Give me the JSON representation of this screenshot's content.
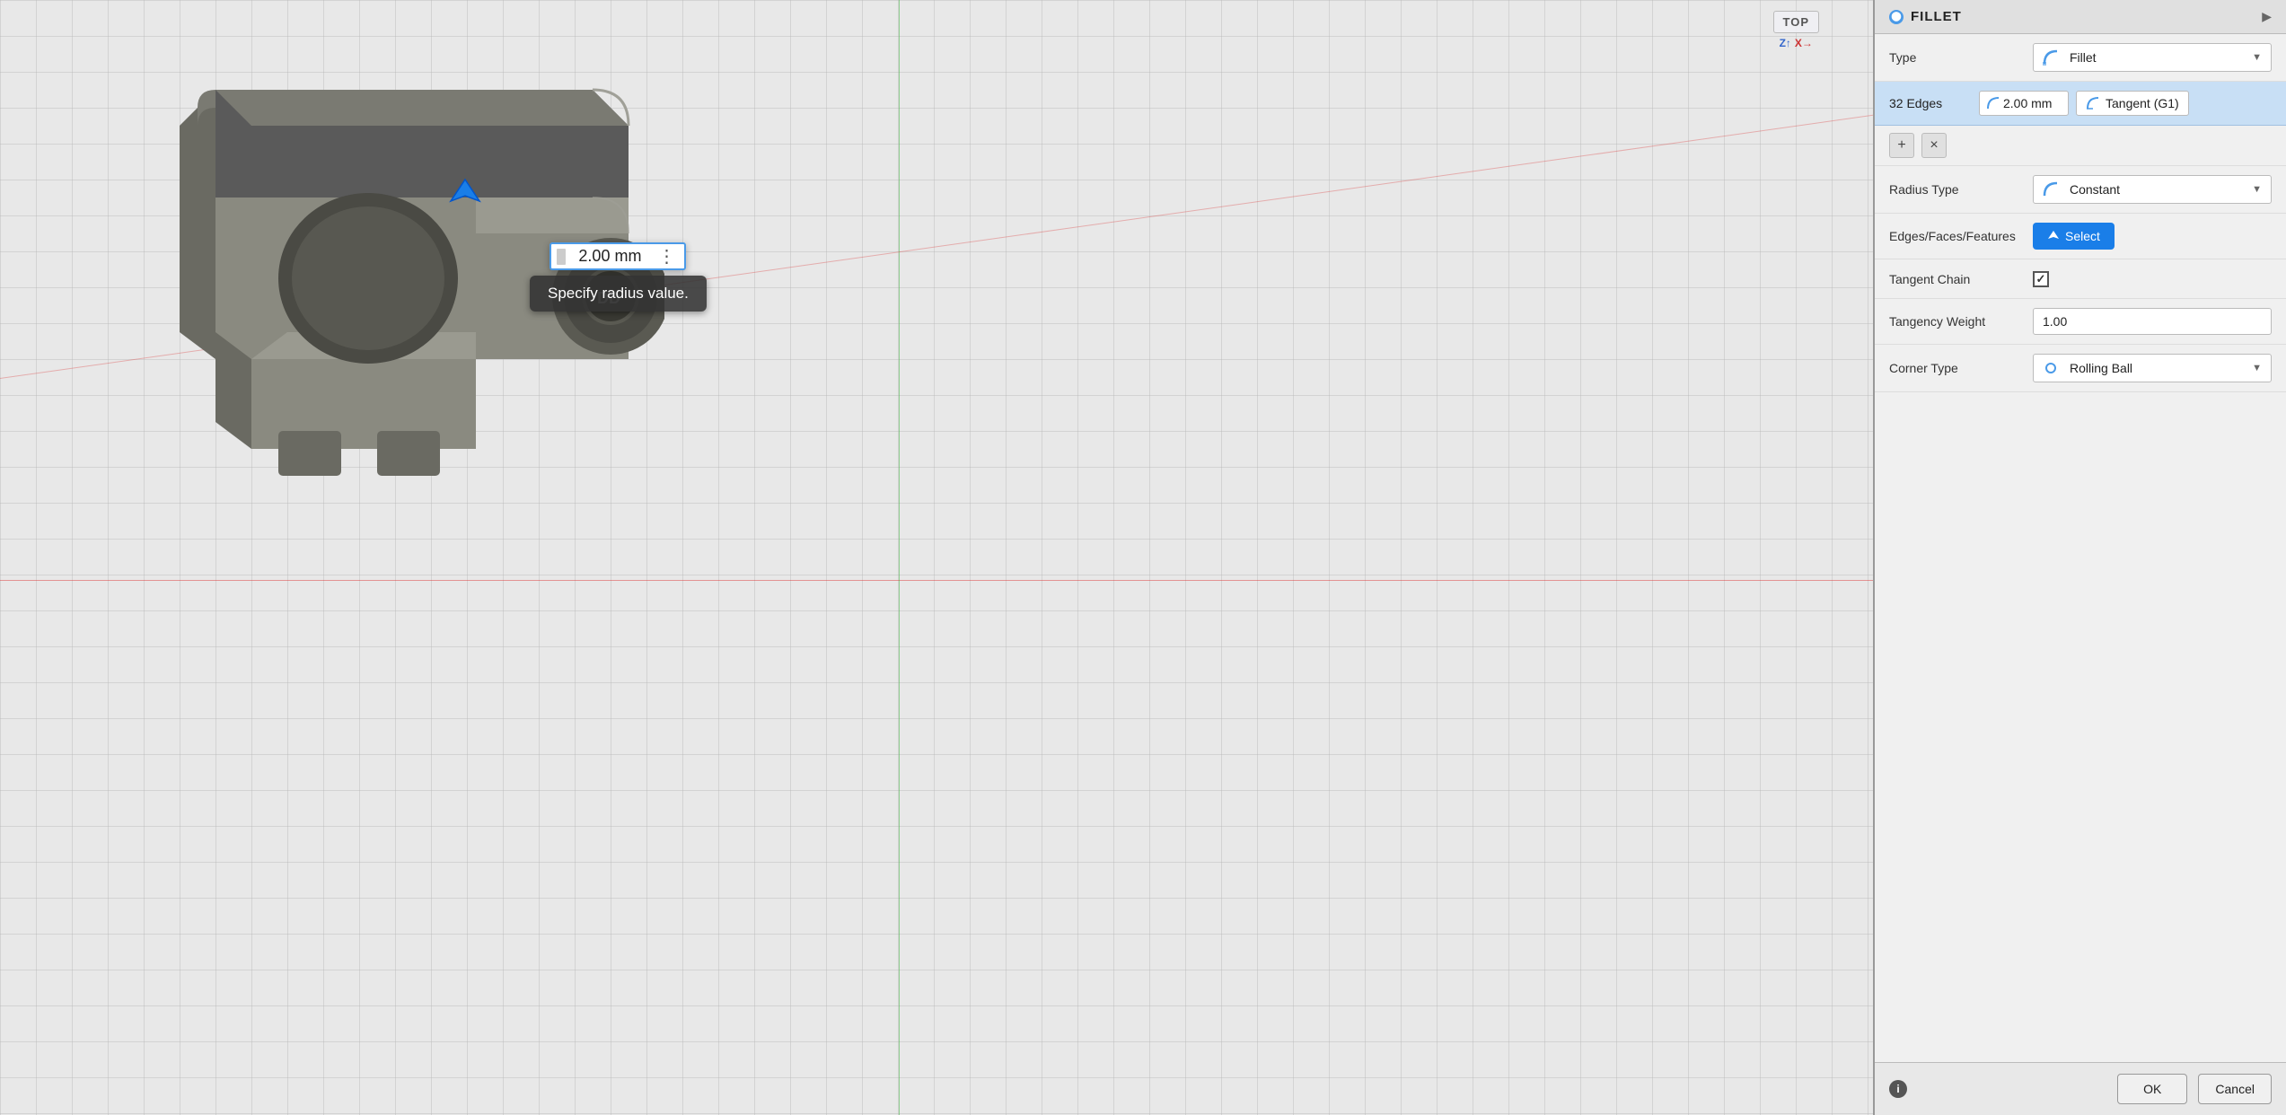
{
  "panel": {
    "title": "FILLET",
    "expand_label": "▶",
    "type_label": "Type",
    "type_value": "Fillet",
    "edges_label": "32 Edges",
    "edges_mm": "2.00 mm",
    "edges_tangent": "Tangent (G1)",
    "add_btn_label": "+",
    "remove_btn_label": "×",
    "radius_type_label": "Radius Type",
    "radius_type_value": "Constant",
    "edges_faces_label": "Edges/Faces/Features",
    "select_btn_label": "Select",
    "tangent_chain_label": "Tangent Chain",
    "tangent_chain_checked": true,
    "tangency_weight_label": "Tangency Weight",
    "tangency_weight_value": "1.00",
    "corner_type_label": "Corner Type",
    "corner_type_value": "Rolling Ball",
    "ok_label": "OK",
    "cancel_label": "Cancel"
  },
  "viewport": {
    "tooltip_text": "Specify radius value.",
    "radius_value": "2.00 mm",
    "view_face": "TOP",
    "axis_z": "Z↑",
    "axis_x": "X→"
  }
}
